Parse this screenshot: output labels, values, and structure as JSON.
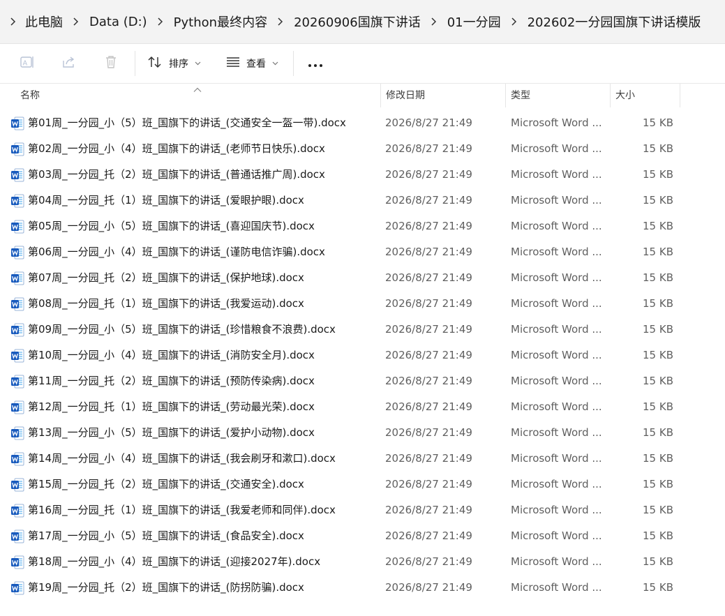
{
  "breadcrumb": {
    "items": [
      "此电脑",
      "Data (D:)",
      "Python最终内容",
      "20260906国旗下讲话",
      "01一分园",
      "202602一分园国旗下讲话模版"
    ]
  },
  "toolbar": {
    "rename_icon": "rename-icon",
    "share_icon": "share-icon",
    "delete_icon": "trash-icon",
    "sort_label": "排序",
    "view_label": "查看",
    "more_icon": "more-icon"
  },
  "columns": {
    "name": "名称",
    "date": "修改日期",
    "type": "类型",
    "size": "大小"
  },
  "files": [
    {
      "name": "第01周_一分园_小（5）班_国旗下的讲话_(交通安全一盔一带).docx",
      "date": "2026/8/27 21:49",
      "type": "Microsoft Word ...",
      "size": "15 KB"
    },
    {
      "name": "第02周_一分园_小（4）班_国旗下的讲话_(老师节日快乐).docx",
      "date": "2026/8/27 21:49",
      "type": "Microsoft Word ...",
      "size": "15 KB"
    },
    {
      "name": "第03周_一分园_托（2）班_国旗下的讲话_(普通话推广周).docx",
      "date": "2026/8/27 21:49",
      "type": "Microsoft Word ...",
      "size": "15 KB"
    },
    {
      "name": "第04周_一分园_托（1）班_国旗下的讲话_(爱眼护眼).docx",
      "date": "2026/8/27 21:49",
      "type": "Microsoft Word ...",
      "size": "15 KB"
    },
    {
      "name": "第05周_一分园_小（5）班_国旗下的讲话_(喜迎国庆节).docx",
      "date": "2026/8/27 21:49",
      "type": "Microsoft Word ...",
      "size": "15 KB"
    },
    {
      "name": "第06周_一分园_小（4）班_国旗下的讲话_(谨防电信诈骗).docx",
      "date": "2026/8/27 21:49",
      "type": "Microsoft Word ...",
      "size": "15 KB"
    },
    {
      "name": "第07周_一分园_托（2）班_国旗下的讲话_(保护地球).docx",
      "date": "2026/8/27 21:49",
      "type": "Microsoft Word ...",
      "size": "15 KB"
    },
    {
      "name": "第08周_一分园_托（1）班_国旗下的讲话_(我爱运动).docx",
      "date": "2026/8/27 21:49",
      "type": "Microsoft Word ...",
      "size": "15 KB"
    },
    {
      "name": "第09周_一分园_小（5）班_国旗下的讲话_(珍惜粮食不浪费).docx",
      "date": "2026/8/27 21:49",
      "type": "Microsoft Word ...",
      "size": "15 KB"
    },
    {
      "name": "第10周_一分园_小（4）班_国旗下的讲话_(消防安全月).docx",
      "date": "2026/8/27 21:49",
      "type": "Microsoft Word ...",
      "size": "15 KB"
    },
    {
      "name": "第11周_一分园_托（2）班_国旗下的讲话_(预防传染病).docx",
      "date": "2026/8/27 21:49",
      "type": "Microsoft Word ...",
      "size": "15 KB"
    },
    {
      "name": "第12周_一分园_托（1）班_国旗下的讲话_(劳动最光荣).docx",
      "date": "2026/8/27 21:49",
      "type": "Microsoft Word ...",
      "size": "15 KB"
    },
    {
      "name": "第13周_一分园_小（5）班_国旗下的讲话_(爱护小动物).docx",
      "date": "2026/8/27 21:49",
      "type": "Microsoft Word ...",
      "size": "15 KB"
    },
    {
      "name": "第14周_一分园_小（4）班_国旗下的讲话_(我会刷牙和漱口).docx",
      "date": "2026/8/27 21:49",
      "type": "Microsoft Word ...",
      "size": "15 KB"
    },
    {
      "name": "第15周_一分园_托（2）班_国旗下的讲话_(交通安全).docx",
      "date": "2026/8/27 21:49",
      "type": "Microsoft Word ...",
      "size": "15 KB"
    },
    {
      "name": "第16周_一分园_托（1）班_国旗下的讲话_(我爱老师和同伴).docx",
      "date": "2026/8/27 21:49",
      "type": "Microsoft Word ...",
      "size": "15 KB"
    },
    {
      "name": "第17周_一分园_小（5）班_国旗下的讲话_(食品安全).docx",
      "date": "2026/8/27 21:49",
      "type": "Microsoft Word ...",
      "size": "15 KB"
    },
    {
      "name": "第18周_一分园_小（4）班_国旗下的讲话_(迎接2027年).docx",
      "date": "2026/8/27 21:49",
      "type": "Microsoft Word ...",
      "size": "15 KB"
    },
    {
      "name": "第19周_一分园_托（2）班_国旗下的讲话_(防拐防骗).docx",
      "date": "2026/8/27 21:49",
      "type": "Microsoft Word ...",
      "size": "15 KB"
    }
  ],
  "colors": {
    "word_blue": "#185abd",
    "word_light": "#41a5ee"
  }
}
